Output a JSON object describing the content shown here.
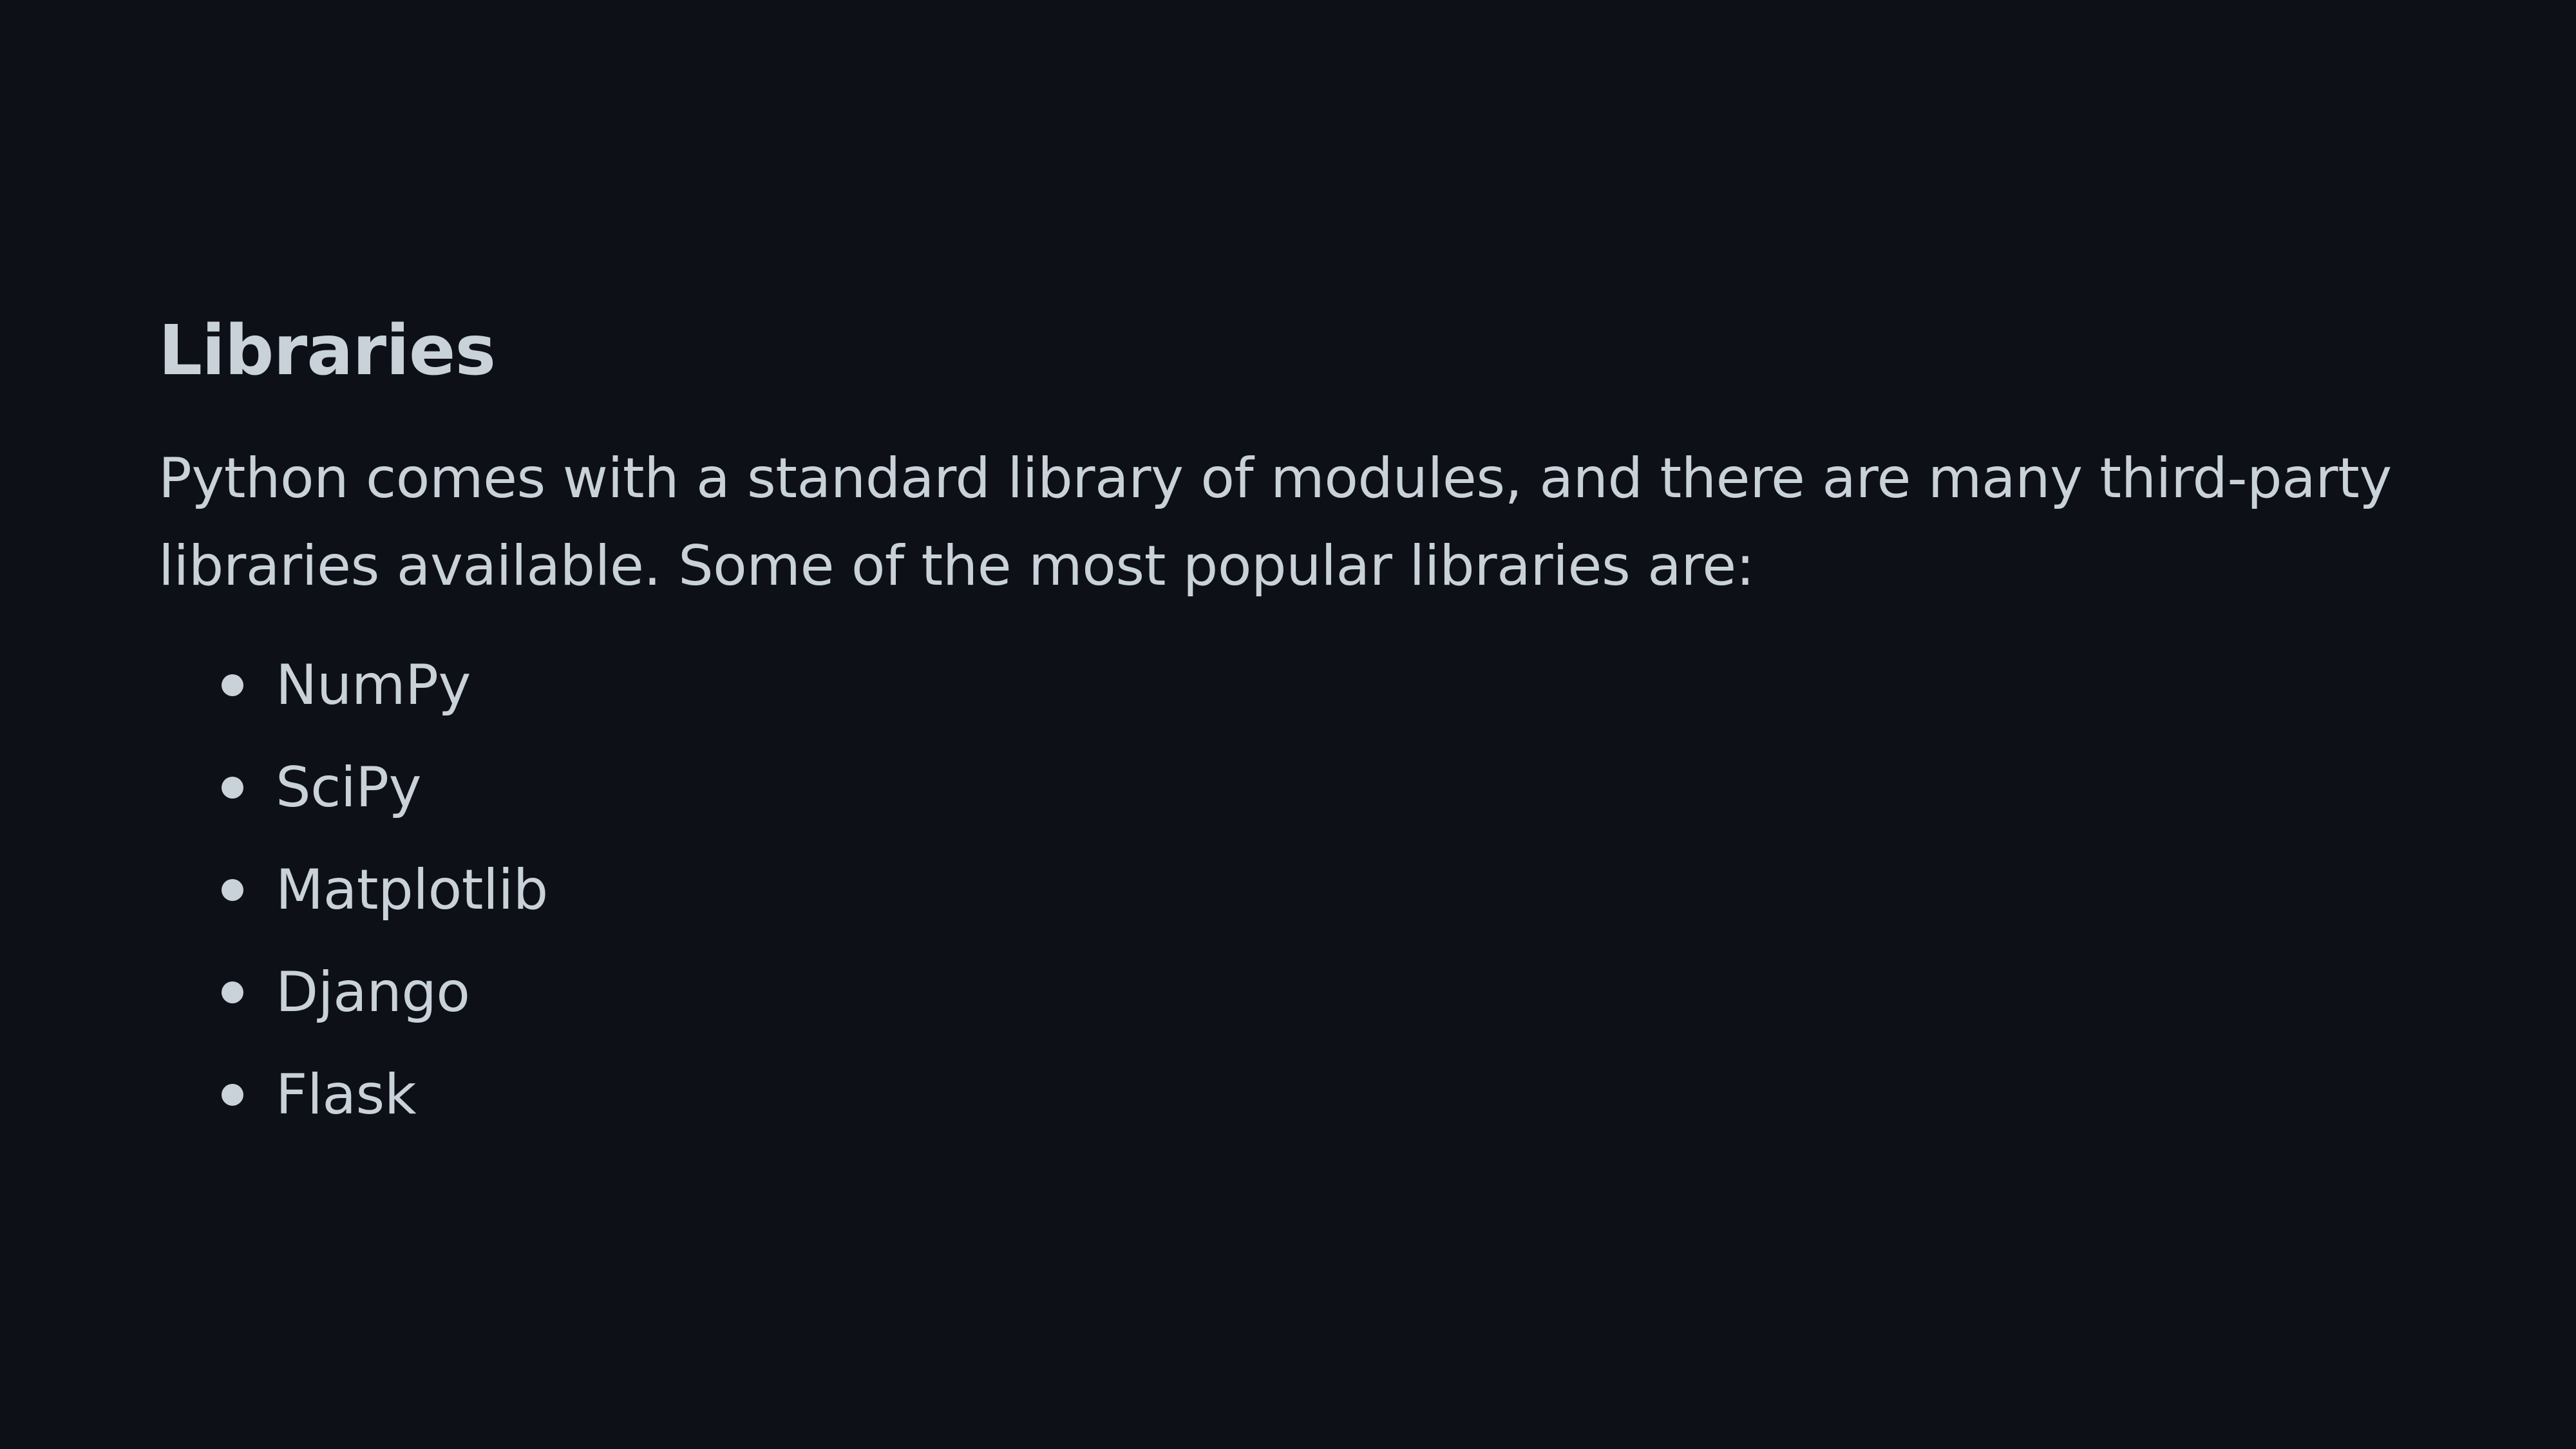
{
  "section": {
    "heading": "Libraries",
    "paragraph": "Python comes with a standard library of modules, and there are many third-party libraries available. Some of the most popular libraries are:",
    "libraries": [
      "NumPy",
      "SciPy",
      "Matplotlib",
      "Django",
      "Flask"
    ]
  },
  "colors": {
    "background": "#0d1117",
    "text": "#c9d1d9"
  }
}
